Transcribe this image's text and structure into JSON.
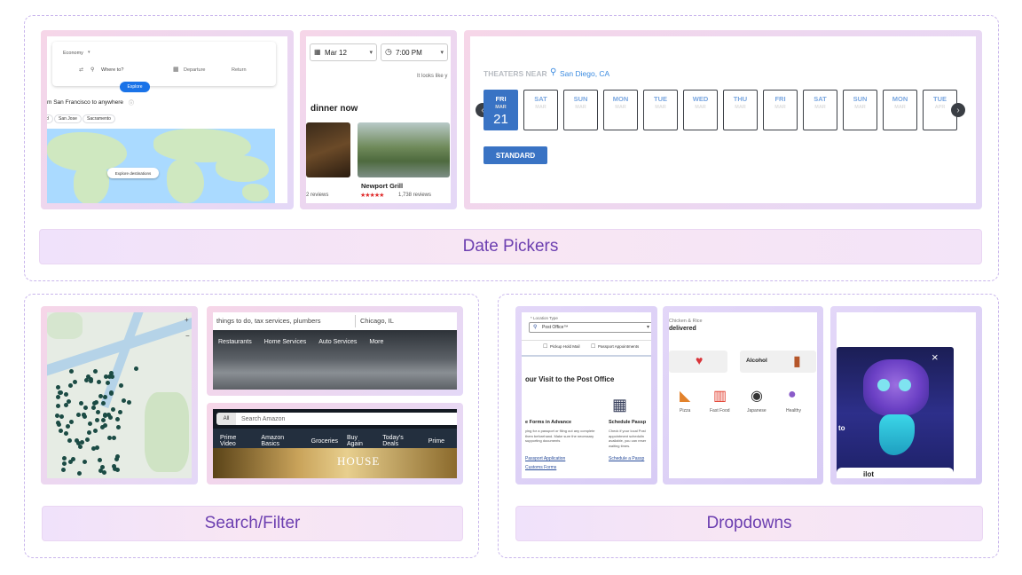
{
  "sections": {
    "date_pickers": "Date Pickers",
    "search_filter": "Search/Filter",
    "dropdowns": "Dropdowns"
  },
  "flights": {
    "class_select": "Economy",
    "where_to": "Where to?",
    "departure": "Departure",
    "return": "Return",
    "explore": "Explore",
    "heading": "m San Francisco to anywhere",
    "chips": [
      "d",
      "San Jose",
      "Sacramento"
    ],
    "map_button": "Explore destinations"
  },
  "yelp": {
    "date": "Mar 12",
    "time": "7:00 PM",
    "hint": "It looks like y",
    "heading": "dinner now",
    "left_reviews": "2 reviews",
    "restaurant": "Newport Grill",
    "reviews": "1,738 reviews"
  },
  "theater": {
    "near_label": "THEATERS NEAR",
    "city": "San Diego, CA",
    "days": [
      {
        "name": "FRI",
        "month": "MAR",
        "date": "21"
      },
      {
        "name": "SAT",
        "month": "MAR",
        "date": "22"
      },
      {
        "name": "SUN",
        "month": "MAR",
        "date": "23"
      },
      {
        "name": "MON",
        "month": "MAR",
        "date": "24"
      },
      {
        "name": "TUE",
        "month": "MAR",
        "date": "25"
      },
      {
        "name": "WED",
        "month": "MAR",
        "date": "26"
      },
      {
        "name": "THU",
        "month": "MAR",
        "date": "27"
      },
      {
        "name": "FRI",
        "month": "MAR",
        "date": "28"
      },
      {
        "name": "SAT",
        "month": "MAR",
        "date": "29"
      },
      {
        "name": "SUN",
        "month": "MAR",
        "date": "30"
      },
      {
        "name": "MON",
        "month": "MAR",
        "date": "31"
      },
      {
        "name": "TUE",
        "month": "APR",
        "date": "01"
      }
    ],
    "standard": "STANDARD"
  },
  "yelp_search": {
    "find": "things to do, tax services, plumbers",
    "near": "Chicago, IL",
    "nav": [
      "Restaurants",
      "Home Services",
      "Auto Services",
      "More"
    ]
  },
  "amazon": {
    "dept": "All",
    "search_placeholder": "Search Amazon",
    "nav": [
      "Prime Video",
      "Amazon Basics",
      "Groceries",
      "Buy Again",
      "Today's Deals",
      "Prime"
    ],
    "banner": "HOUSE"
  },
  "usps": {
    "select_label": "* Location Type",
    "select_value": "Post Office™",
    "check1": "Pickup Hold Mail",
    "check2": "Passport Appointments",
    "heading": "our Visit to the Post Office",
    "col1_title": "e Forms in Advance",
    "col1_text": "ying for a passport or filing out any complete them beforehand. Make sure the necessary supporting documents",
    "col2_title": "Schedule Passp",
    "col2_text": "Check if your local Post appointment schedulin available, you can reser waiting times.",
    "link1": "Passport Application",
    "link2": "Customs Forms",
    "link3": "Schedule a Passp"
  },
  "food": {
    "top1": "Chicken & Rice",
    "top2": "delivered",
    "alcohol": "Alcohol",
    "items": [
      "Pizza",
      "Fast Food",
      "Japanese",
      "Healthy"
    ]
  },
  "promo": {
    "close": "×",
    "letter_t": "t",
    "word_to": "to",
    "bottom": "ilot"
  }
}
